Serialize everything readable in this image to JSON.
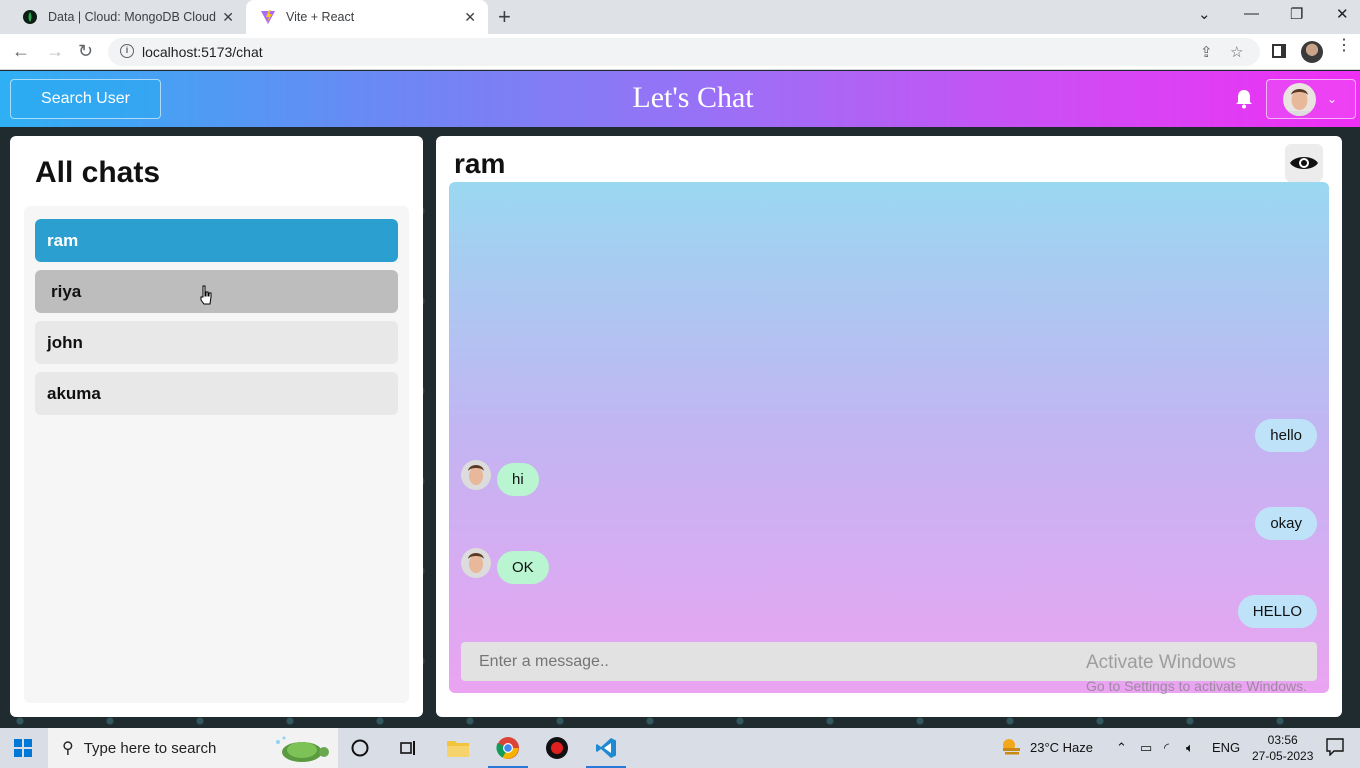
{
  "browser": {
    "tabs": [
      {
        "title": "Data | Cloud: MongoDB Cloud",
        "active": false
      },
      {
        "title": "Vite + React",
        "active": true
      }
    ],
    "url": "localhost:5173/chat"
  },
  "header": {
    "search_label": "Search User",
    "brand": "Let's Chat"
  },
  "sidebar": {
    "title": "All chats",
    "chats": [
      {
        "name": "ram",
        "state": "active"
      },
      {
        "name": "riya",
        "state": "hover"
      },
      {
        "name": "john",
        "state": "normal"
      },
      {
        "name": "akuma",
        "state": "normal"
      }
    ]
  },
  "chat": {
    "name": "ram",
    "messages": [
      {
        "text": "hello",
        "from": "me"
      },
      {
        "text": "hi",
        "from": "them"
      },
      {
        "text": "okay",
        "from": "me"
      },
      {
        "text": "OK",
        "from": "them"
      },
      {
        "text": "HELLO",
        "from": "me"
      }
    ],
    "composer_placeholder": "Enter a message..",
    "watermark_line1": "Activate Windows",
    "watermark_line2": "Go to Settings to activate Windows."
  },
  "taskbar": {
    "search_placeholder": "Type here to search",
    "weather": "23°C  Haze",
    "language": "ENG",
    "time": "03:56",
    "date": "27-05-2023"
  },
  "colors": {
    "accent": "#2b9fd0",
    "header_gradient_start": "#2fb0f4",
    "header_gradient_end": "#ef2ef4",
    "my_bubble": "#bee3f8",
    "their_bubble": "#b9f5d0"
  }
}
